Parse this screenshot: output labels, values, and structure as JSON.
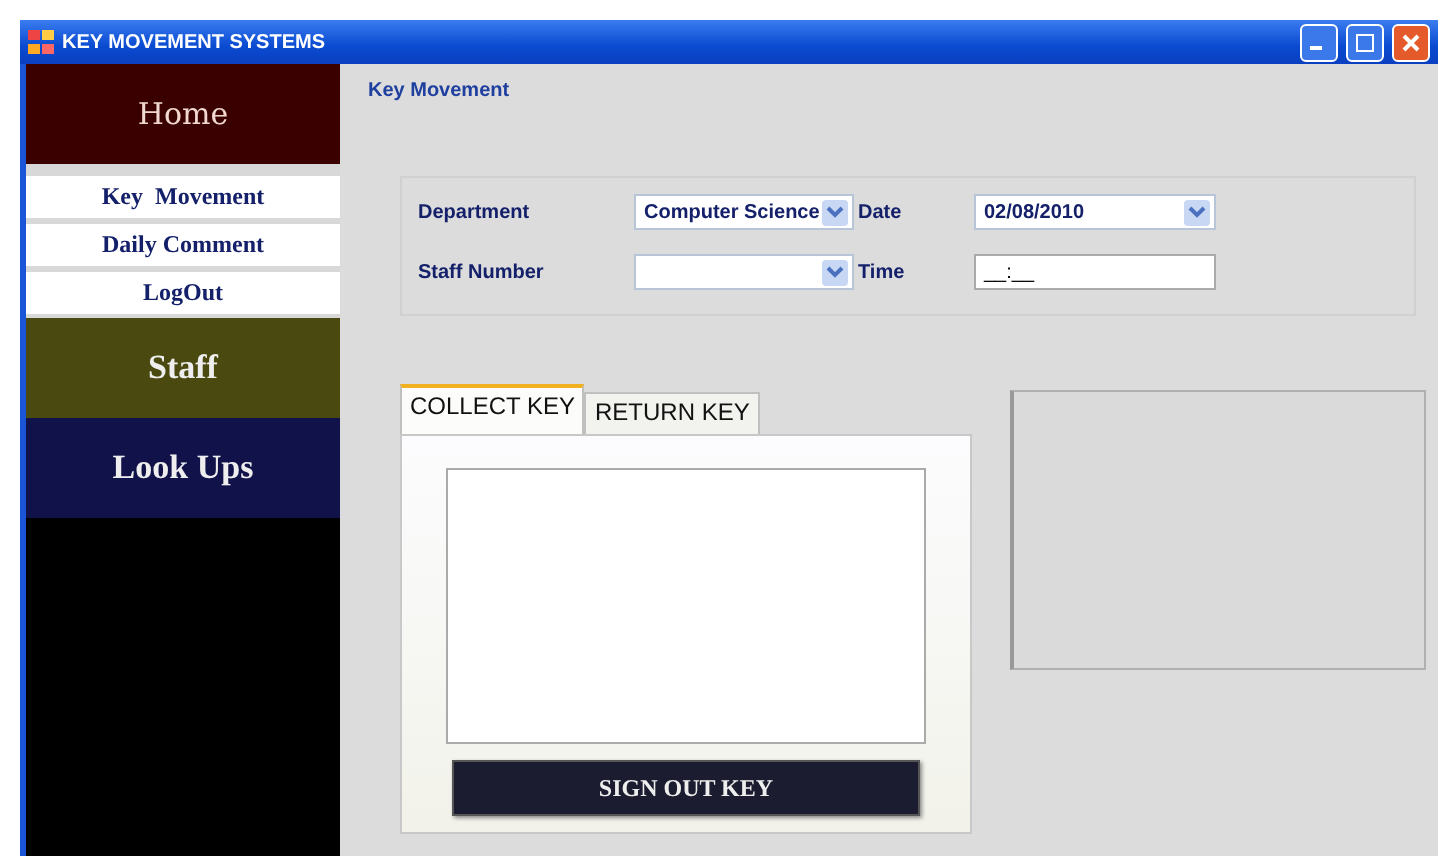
{
  "window": {
    "title": "KEY MOVEMENT SYSTEMS"
  },
  "sidebar": {
    "sections": [
      {
        "label": "Home",
        "kind": "header",
        "color": "#3a0000"
      },
      {
        "label": "Key  Movement",
        "kind": "link"
      },
      {
        "label": "Daily Comment",
        "kind": "link"
      },
      {
        "label": "LogOut",
        "kind": "link"
      },
      {
        "label": "Staff",
        "kind": "header",
        "color": "#4a4a10"
      },
      {
        "label": "Look Ups",
        "kind": "header",
        "color": "#12124a"
      }
    ]
  },
  "page_title": "Key Movement",
  "form": {
    "department": {
      "label": "Department",
      "value": "Computer Science"
    },
    "staff_number": {
      "label": "Staff Number"
    },
    "date": {
      "label": "Date",
      "value": "02/08/2010"
    },
    "time": {
      "label": "Time",
      "value": "__:__"
    }
  },
  "tabs": [
    {
      "label": "COLLECT KEY",
      "selected": true
    },
    {
      "label": "RETURN KEY",
      "selected": false
    }
  ],
  "sign_out_button": "SIGN OUT KEY"
}
